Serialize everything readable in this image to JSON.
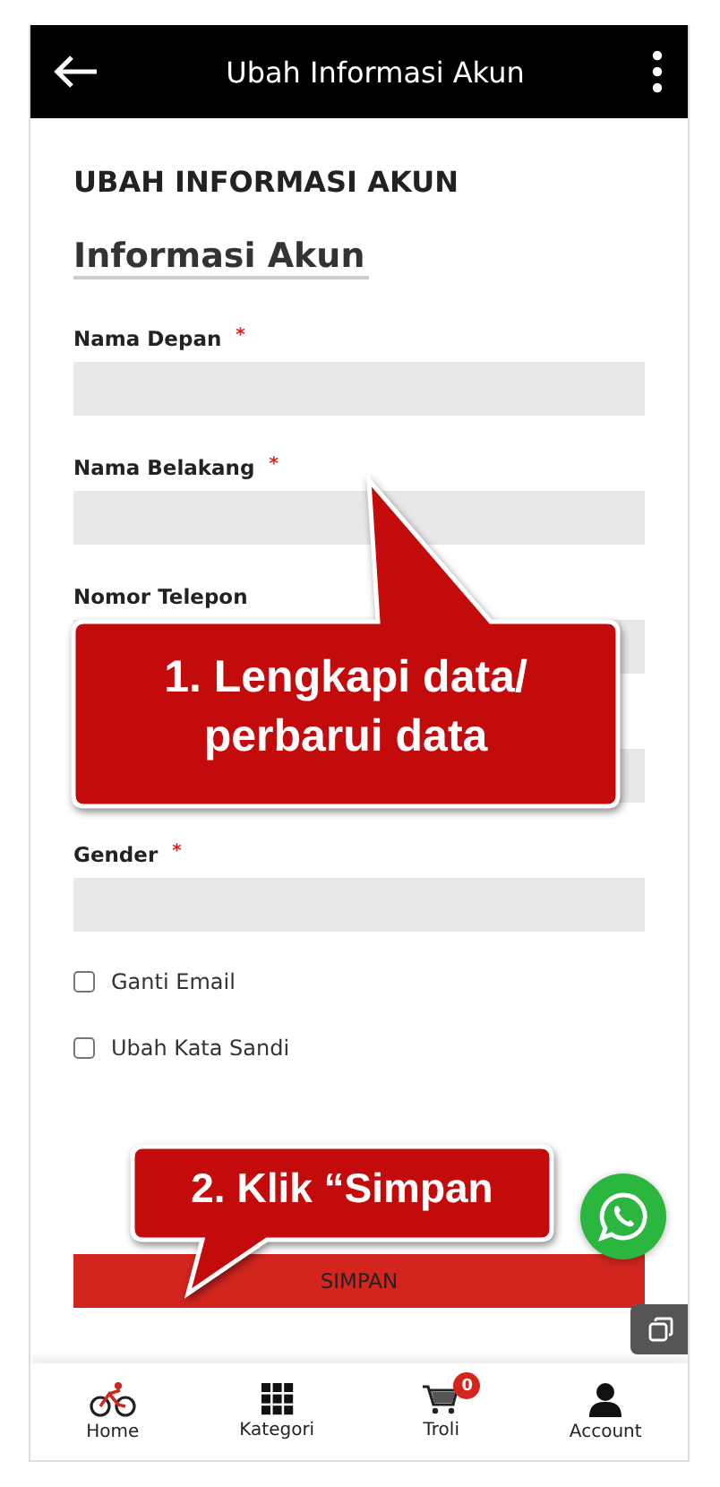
{
  "header": {
    "title": "Ubah Informasi Akun"
  },
  "page_title": "UBAH INFORMASI AKUN",
  "section_title": "Informasi Akun",
  "fields": [
    {
      "kind": "labeled",
      "label": "Nama Depan",
      "required_mark": "*"
    },
    {
      "kind": "labeled",
      "label": "Nama Belakang",
      "required_mark": "*"
    },
    {
      "kind": "labeled",
      "label": "Nomor Telepon"
    },
    {
      "kind": "covered"
    },
    {
      "kind": "labeled",
      "label": "Gender",
      "required_mark": "*"
    }
  ],
  "checkboxes": [
    {
      "label": "Ganti Email",
      "checked": false
    },
    {
      "label": "Ubah Kata Sandi",
      "checked": false
    }
  ],
  "submit": "SIMPAN",
  "callouts": [
    {
      "kind": "form",
      "lines": [
        "1. Lengkapi data/",
        "perbarui data"
      ]
    },
    {
      "kind": "save",
      "lines": [
        "2. Klik “Simpan"
      ]
    }
  ],
  "nav": [
    {
      "kind": "home",
      "label": "Home"
    },
    {
      "kind": "grid",
      "label": "Kategori"
    },
    {
      "kind": "cart",
      "label": "Troli",
      "badge": "0"
    },
    {
      "kind": "user",
      "label": "Account"
    }
  ]
}
